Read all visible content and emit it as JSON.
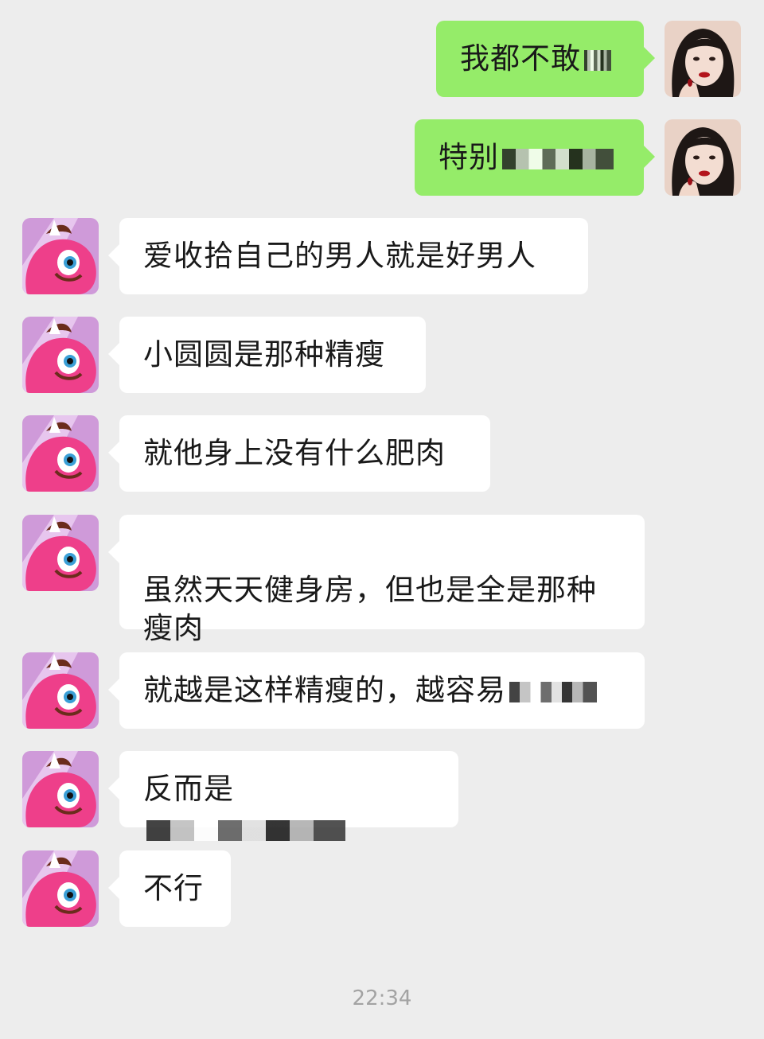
{
  "messages": [
    {
      "side": "right",
      "text": "我都不敢"
    },
    {
      "side": "right",
      "text": "特别"
    },
    {
      "side": "left",
      "text": "爱收拾自己的男人就是好男人"
    },
    {
      "side": "left",
      "text": "小圆圆是那种精瘦"
    },
    {
      "side": "left",
      "text": "就他身上没有什么肥肉"
    },
    {
      "side": "left",
      "text": "虽然天天健身房，但也是全是那种\n瘦肉"
    },
    {
      "side": "left",
      "text": "就越是这样精瘦的，越容易"
    },
    {
      "side": "left",
      "text": "反而是"
    },
    {
      "side": "left",
      "text": "不行"
    }
  ],
  "timestamp": "22:34",
  "colors": {
    "background": "#ededed",
    "self_bubble": "#95ec69",
    "other_bubble": "#ffffff",
    "text": "#191919",
    "time_text": "#a3a3a3"
  },
  "icons": {
    "self_avatar": "woman-portrait-avatar",
    "other_avatar": "pink-cartoon-pony-avatar"
  }
}
